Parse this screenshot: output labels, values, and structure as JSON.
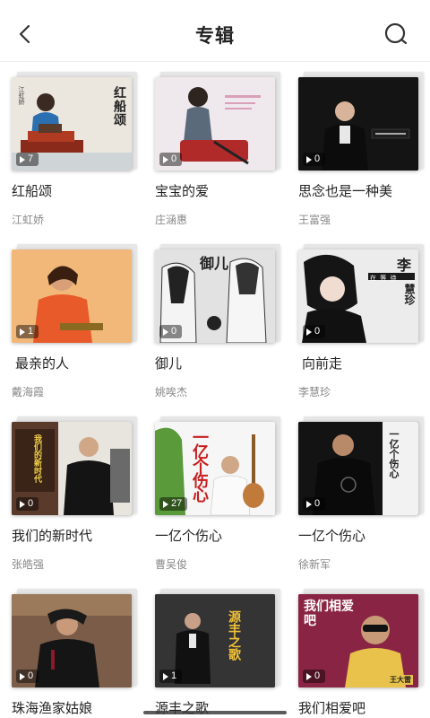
{
  "header": {
    "title": "专辑"
  },
  "albums": [
    {
      "name": "红船颂",
      "artist": "江虹娇",
      "count": "7",
      "cover_text": "红船颂",
      "cover_text2": "江虹娇",
      "bg": "#e9e4dc"
    },
    {
      "name": "宝宝的爱",
      "artist": "庄涵惠",
      "count": "0",
      "bg": "#ece6ea"
    },
    {
      "name": "思念也是一种美",
      "artist": "王富强",
      "count": "0",
      "bg": "#1a1a1a"
    },
    {
      "name": "最亲的人",
      "artist": "戴海霞",
      "count": "1",
      "bg": "#f2b070"
    },
    {
      "name": "御儿",
      "artist": "姚唉杰",
      "count": "0",
      "cover_text": "御儿",
      "bg": "#d9d9d9"
    },
    {
      "name": "向前走",
      "artist": "李慧珍",
      "count": "0",
      "cover_text": "李",
      "cover_text2": "慧珍",
      "cover_text3": "在 等 待",
      "bg": "#e6e6e6"
    },
    {
      "name": "我们的新时代",
      "artist": "张皓强",
      "count": "0",
      "cover_text": "我们的新时代",
      "bg": "#5a3a2a"
    },
    {
      "name": "一亿个伤心",
      "artist": "曹吴俊",
      "count": "27",
      "cover_text": "一亿个伤心",
      "bg": "#f4f4f4"
    },
    {
      "name": "一亿个伤心",
      "artist": "徐新军",
      "count": "0",
      "cover_text": "一亿个伤心",
      "bg": "#111111"
    },
    {
      "name": "珠海渔家姑娘",
      "artist": "",
      "count": "0",
      "bg": "#6b5040"
    },
    {
      "name": "源丰之歌",
      "artist": "",
      "count": "1",
      "cover_text": "源丰之歌",
      "bg": "#2b2b2b"
    },
    {
      "name": "我们相爱吧",
      "artist": "",
      "count": "0",
      "cover_text": "我们相爱吧",
      "cover_text2": "王大雷",
      "bg": "#7a1f3a"
    }
  ]
}
